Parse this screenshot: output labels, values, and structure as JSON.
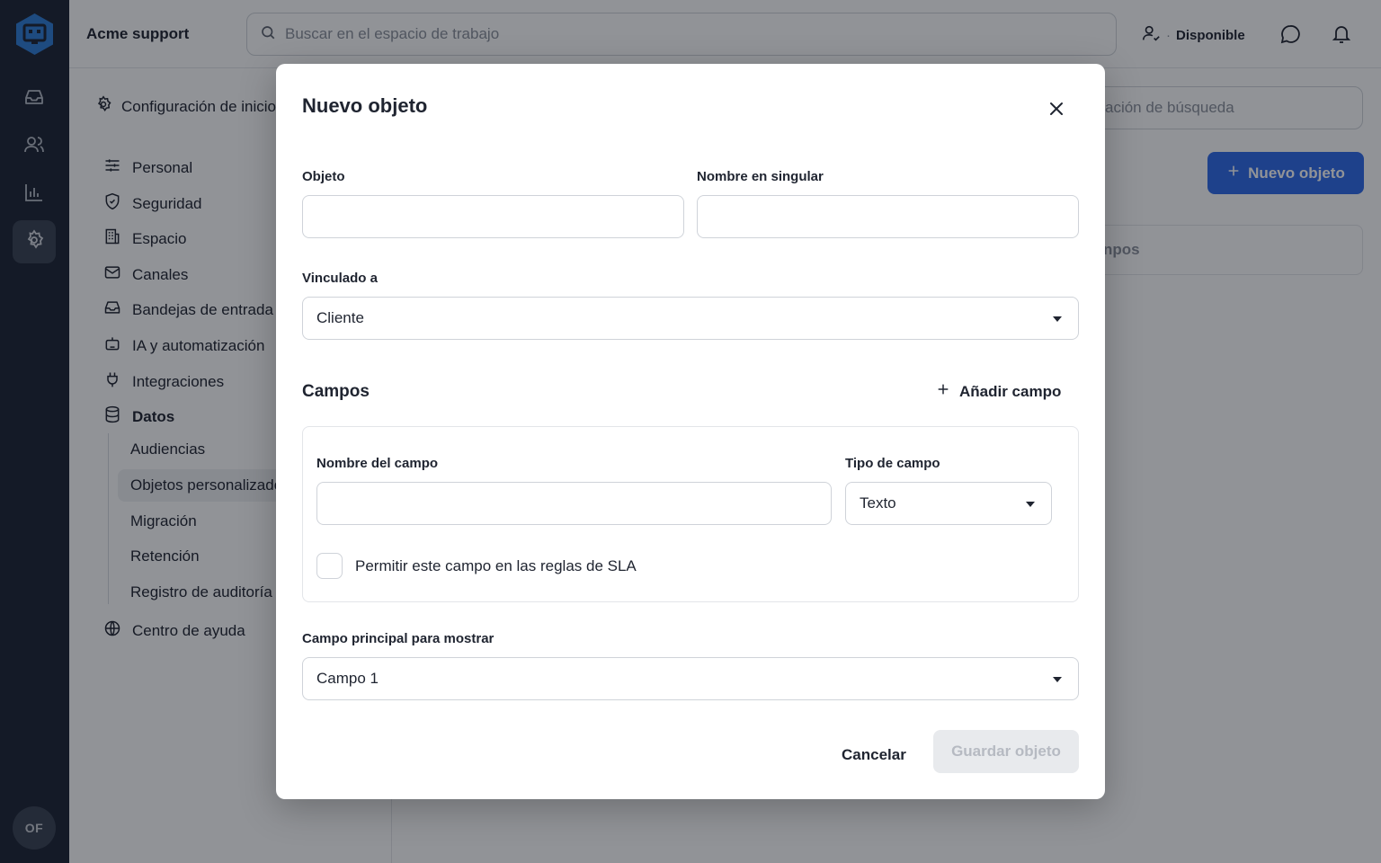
{
  "app": {
    "workspace_name": "Acme support",
    "user_initials": "OF"
  },
  "header": {
    "search_placeholder": "Buscar en el espacio de trabajo",
    "status_label": "Disponible",
    "status_separator": "·"
  },
  "settings": {
    "title": "Configuración de inicio",
    "items": [
      {
        "label": "Personal",
        "icon": "sliders-icon"
      },
      {
        "label": "Seguridad",
        "icon": "shield-icon"
      },
      {
        "label": "Espacio",
        "icon": "building-icon"
      },
      {
        "label": "Canales",
        "icon": "mail-icon"
      },
      {
        "label": "Bandejas de entrada",
        "icon": "inbox-icon"
      },
      {
        "label": "IA y automatización",
        "icon": "robot-icon"
      },
      {
        "label": "Integraciones",
        "icon": "plug-icon"
      },
      {
        "label": "Datos",
        "icon": "database-icon"
      }
    ],
    "data_subitems": [
      {
        "label": "Audiencias"
      },
      {
        "label": "Objetos personalizados",
        "active": true
      },
      {
        "label": "Migración"
      },
      {
        "label": "Retención"
      },
      {
        "label": "Registro de auditoría"
      }
    ],
    "help_center": "Centro de ayuda"
  },
  "content": {
    "search_placeholder_partial": "ación de búsqueda",
    "new_object_button": "Nuevo objeto",
    "card_text_partial": "npos"
  },
  "modal": {
    "title": "Nuevo objeto",
    "object_label": "Objeto",
    "object_value": "",
    "singular_label": "Nombre en singular",
    "singular_value": "",
    "linked_label": "Vinculado a",
    "linked_value": "Cliente",
    "fields_title": "Campos",
    "add_field_label": "Añadir campo",
    "field": {
      "name_label": "Nombre del campo",
      "name_value": "",
      "type_label": "Tipo de campo",
      "type_value": "Texto",
      "sla_checkbox_label": "Permitir este campo en las reglas de SLA",
      "sla_checked": false
    },
    "primary_field_label": "Campo principal para mostrar",
    "primary_field_value": "Campo 1",
    "cancel_label": "Cancelar",
    "save_label": "Guardar objeto",
    "save_enabled": false
  },
  "colors": {
    "rail_bg": "#1c2433",
    "accent": "#2f6bea",
    "logo": "#2f7cd6"
  }
}
